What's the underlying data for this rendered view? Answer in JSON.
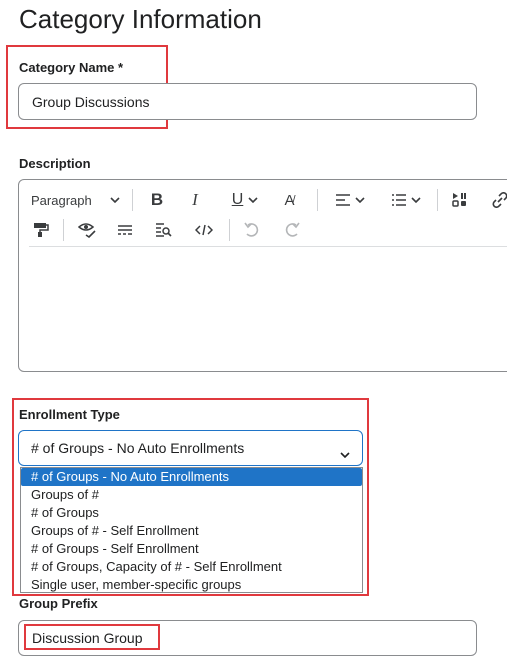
{
  "page_title": "Category Information",
  "category_name": {
    "label": "Category Name *",
    "value": "Group Discussions"
  },
  "description": {
    "label": "Description",
    "toolbar": {
      "paragraph_label": "Paragraph"
    }
  },
  "enrollment_type": {
    "label": "Enrollment Type",
    "selected": "# of Groups - No Auto Enrollments",
    "options": [
      "# of Groups - No Auto Enrollments",
      "Groups of #",
      "# of Groups",
      "Groups of # - Self Enrollment",
      "# of Groups - Self Enrollment",
      "# of Groups, Capacity of # - Self Enrollment",
      "Single user, member-specific groups"
    ]
  },
  "group_prefix": {
    "label": "Group Prefix",
    "value": "Discussion Group"
  },
  "colors": {
    "highlight_box": "#e0393e",
    "accent": "#1f74c7"
  },
  "icons": [
    "chevron-down-icon",
    "bold-icon",
    "italic-icon",
    "underline-icon",
    "font-color-icon",
    "align-icon",
    "list-icon",
    "media-icon",
    "link-icon",
    "format-painter-icon",
    "preview-icon",
    "hr-icon",
    "find-icon",
    "code-icon",
    "undo-icon",
    "redo-icon"
  ]
}
